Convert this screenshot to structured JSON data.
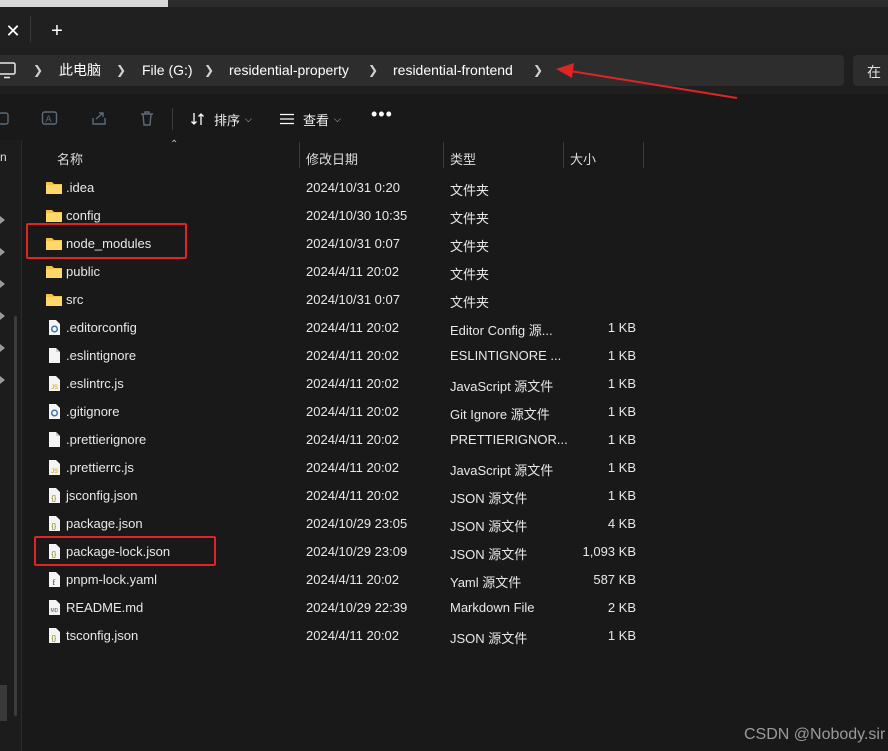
{
  "tab": {
    "close_glyph": "✕",
    "new_glyph": "+"
  },
  "address": {
    "breadcrumbs": [
      "此电脑",
      "File (G:)",
      "residential-property",
      "residential-frontend"
    ],
    "search_placeholder": "在"
  },
  "toolbar": {
    "sort_label": "排序",
    "view_label": "查看",
    "more_label": "•••"
  },
  "nav": {
    "partial_label": "n"
  },
  "columns": {
    "name": "名称",
    "date": "修改日期",
    "type": "类型",
    "size": "大小"
  },
  "files": [
    {
      "name": ".idea",
      "date": "2024/10/31 0:20",
      "type": "文件夹",
      "size": "",
      "icon": "folder-icon"
    },
    {
      "name": "config",
      "date": "2024/10/30 10:35",
      "type": "文件夹",
      "size": "",
      "icon": "folder-icon"
    },
    {
      "name": "node_modules",
      "date": "2024/10/31 0:07",
      "type": "文件夹",
      "size": "",
      "icon": "folder-icon"
    },
    {
      "name": "public",
      "date": "2024/4/11 20:02",
      "type": "文件夹",
      "size": "",
      "icon": "folder-icon"
    },
    {
      "name": "src",
      "date": "2024/10/31 0:07",
      "type": "文件夹",
      "size": "",
      "icon": "folder-icon"
    },
    {
      "name": ".editorconfig",
      "date": "2024/4/11 20:02",
      "type": "Editor Config 源...",
      "size": "1 KB",
      "icon": "gear-file-icon"
    },
    {
      "name": ".eslintignore",
      "date": "2024/4/11 20:02",
      "type": "ESLINTIGNORE ...",
      "size": "1 KB",
      "icon": "blank-file-icon"
    },
    {
      "name": ".eslintrc.js",
      "date": "2024/4/11 20:02",
      "type": "JavaScript 源文件",
      "size": "1 KB",
      "icon": "js-file-icon"
    },
    {
      "name": ".gitignore",
      "date": "2024/4/11 20:02",
      "type": "Git Ignore 源文件",
      "size": "1 KB",
      "icon": "gear-file-icon"
    },
    {
      "name": ".prettierignore",
      "date": "2024/4/11 20:02",
      "type": "PRETTIERIGNOR...",
      "size": "1 KB",
      "icon": "blank-file-icon"
    },
    {
      "name": ".prettierrc.js",
      "date": "2024/4/11 20:02",
      "type": "JavaScript 源文件",
      "size": "1 KB",
      "icon": "js-file-icon"
    },
    {
      "name": "jsconfig.json",
      "date": "2024/4/11 20:02",
      "type": "JSON 源文件",
      "size": "1 KB",
      "icon": "json-file-icon"
    },
    {
      "name": "package.json",
      "date": "2024/10/29 23:05",
      "type": "JSON 源文件",
      "size": "4 KB",
      "icon": "json-file-icon"
    },
    {
      "name": "package-lock.json",
      "date": "2024/10/29 23:09",
      "type": "JSON 源文件",
      "size": "1,093 KB",
      "icon": "json-file-icon"
    },
    {
      "name": "pnpm-lock.yaml",
      "date": "2024/4/11 20:02",
      "type": "Yaml 源文件",
      "size": "587 KB",
      "icon": "yaml-file-icon"
    },
    {
      "name": "README.md",
      "date": "2024/10/29 22:39",
      "type": "Markdown File",
      "size": "2 KB",
      "icon": "md-file-icon"
    },
    {
      "name": "tsconfig.json",
      "date": "2024/4/11 20:02",
      "type": "JSON 源文件",
      "size": "1 KB",
      "icon": "json-file-icon"
    }
  ],
  "highlighted_files": [
    "node_modules",
    "package-lock.json"
  ],
  "watermark": "CSDN @Nobody.sir",
  "colors": {
    "folder": "#f5c242",
    "highlight": "#e02424",
    "background": "#191919"
  }
}
